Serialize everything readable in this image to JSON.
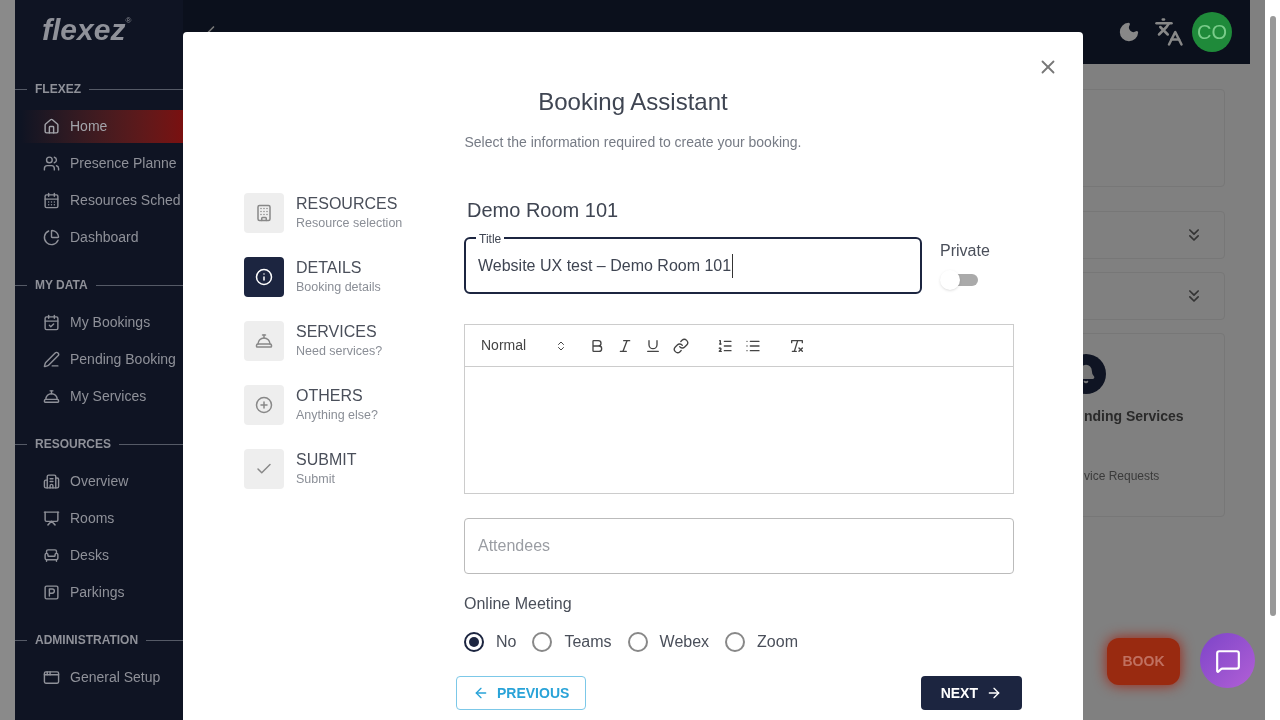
{
  "header": {
    "logo": "flexez",
    "logo_mark": "®",
    "avatar": "CO"
  },
  "sidebar": {
    "sections": [
      {
        "title": "FLEXEZ",
        "items": [
          {
            "label": "Home",
            "selected": true
          },
          {
            "label": "Presence Planne",
            "selected": false
          },
          {
            "label": "Resources Sched",
            "selected": false
          },
          {
            "label": "Dashboard",
            "selected": false
          }
        ]
      },
      {
        "title": "MY DATA",
        "items": [
          {
            "label": "My Bookings",
            "selected": false
          },
          {
            "label": "Pending Booking",
            "selected": false
          },
          {
            "label": "My Services",
            "selected": false
          }
        ]
      },
      {
        "title": "RESOURCES",
        "items": [
          {
            "label": "Overview",
            "selected": false
          },
          {
            "label": "Rooms",
            "selected": false
          },
          {
            "label": "Desks",
            "selected": false
          },
          {
            "label": "Parkings",
            "selected": false
          }
        ]
      },
      {
        "title": "ADMINISTRATION",
        "items": [
          {
            "label": "General Setup",
            "selected": false
          }
        ]
      }
    ]
  },
  "background": {
    "card_title": "nding Services",
    "card_subtitle": "vice Requests",
    "book_button": "BOOK"
  },
  "modal": {
    "title": "Booking Assistant",
    "subtitle": "Select the information required to create your booking.",
    "steps": [
      {
        "title": "RESOURCES",
        "subtitle": "Resource selection",
        "selected": false
      },
      {
        "title": "DETAILS",
        "subtitle": "Booking details",
        "selected": true
      },
      {
        "title": "SERVICES",
        "subtitle": "Need services?",
        "selected": false
      },
      {
        "title": "OTHERS",
        "subtitle": "Anything else?",
        "selected": false
      },
      {
        "title": "SUBMIT",
        "subtitle": "Submit",
        "selected": false
      }
    ],
    "resource_name": "Demo Room 101",
    "title_field": {
      "label": "Title",
      "value": "Website UX test – Demo Room 101"
    },
    "private": {
      "label": "Private",
      "on": false
    },
    "editor": {
      "format": "Normal"
    },
    "attendees": {
      "placeholder": "Attendees"
    },
    "online_meeting": {
      "label": "Online Meeting",
      "options": [
        {
          "label": "No",
          "selected": true
        },
        {
          "label": "Teams",
          "selected": false
        },
        {
          "label": "Webex",
          "selected": false
        },
        {
          "label": "Zoom",
          "selected": false
        }
      ]
    },
    "previous_button": "PREVIOUS",
    "next_button": "NEXT"
  }
}
